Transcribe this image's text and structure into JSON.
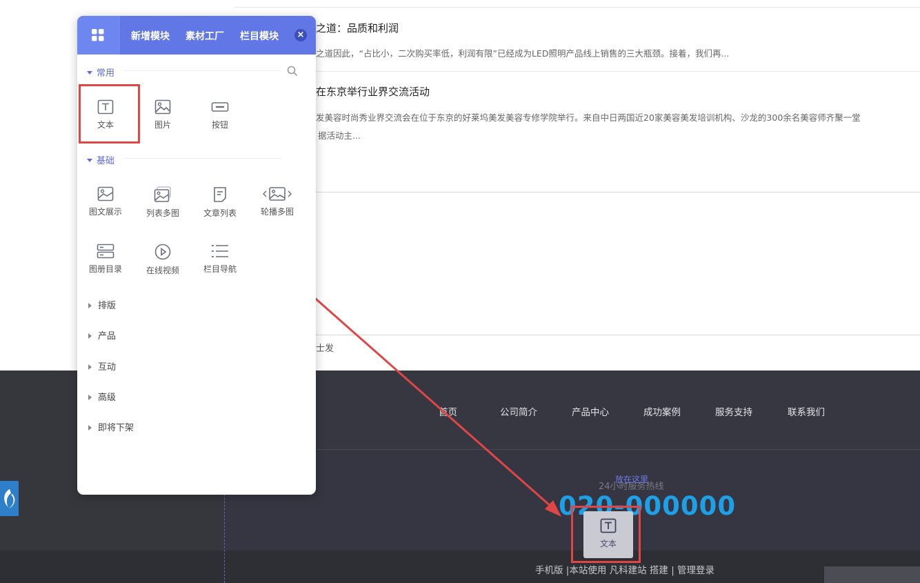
{
  "articles": [
    {
      "title": "之道：品质和利润",
      "desc": "之道因此，“占比小，二次购买率低，利润有限”已经成为LED照明产品线上销售的三大瓶颈。接着，我们再..."
    },
    {
      "title": "在东京举行业界交流活动",
      "desc": "发美容时尚秀业界交流会在位于东京的好莱坞美发美容专修学院举行。来自中日两国近20家美容美发培训机构、沙龙的300余名美容师齐聚一堂",
      "desc2": "据活动主..."
    }
  ],
  "partial_text": "士发",
  "footer": {
    "nav": [
      "首页",
      "公司简介",
      "产品中心",
      "成功案例",
      "服务支持",
      "联系我们"
    ],
    "hotline_label": "24小时服务热线",
    "hotline_number": "020-000000",
    "drop_hint": "放在这里",
    "links": "手机版 |本站使用 凡科建站 搭建 | 管理登录"
  },
  "panel": {
    "tabs": [
      "新增模块",
      "素材工厂",
      "栏目模块"
    ],
    "close_label": "×",
    "sections": {
      "common": {
        "label": "常用",
        "items": [
          {
            "label": "文本",
            "icon": "text-icon"
          },
          {
            "label": "图片",
            "icon": "image-icon"
          },
          {
            "label": "按钮",
            "icon": "button-icon"
          }
        ]
      },
      "basic": {
        "label": "基础",
        "items": [
          {
            "label": "图文展示",
            "icon": "image-text-icon"
          },
          {
            "label": "列表多图",
            "icon": "multi-image-icon"
          },
          {
            "label": "文章列表",
            "icon": "article-list-icon"
          },
          {
            "label": "轮播多图",
            "icon": "carousel-icon"
          },
          {
            "label": "图册目录",
            "icon": "album-icon"
          },
          {
            "label": "在线视频",
            "icon": "video-icon"
          },
          {
            "label": "栏目导航",
            "icon": "nav-list-icon"
          }
        ]
      }
    },
    "collapsed_sections": [
      "排版",
      "产品",
      "互动",
      "高级",
      "即将下架"
    ]
  },
  "drag_ghost": {
    "label": "文本",
    "icon": "text-icon"
  },
  "colors": {
    "panel_header": "#6177e6",
    "accent": "#5b6ce0",
    "highlight": "#e04646",
    "hotline": "#1ea0e6",
    "footer": "#36363d"
  }
}
